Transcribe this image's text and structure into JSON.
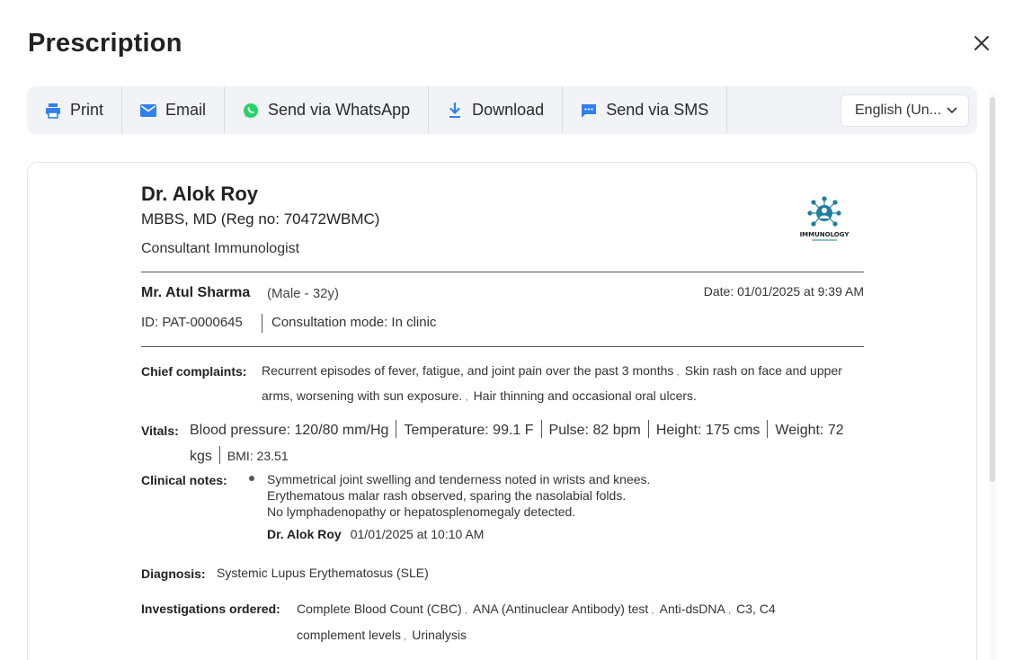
{
  "modal": {
    "title": "Prescription"
  },
  "toolbar": {
    "print": "Print",
    "email": "Email",
    "whatsapp": "Send via WhatsApp",
    "download": "Download",
    "sms": "Send via SMS",
    "language": "English (Un..."
  },
  "doctor": {
    "name": "Dr. Alok Roy",
    "qualification": "MBBS, MD (Reg no: 70472WBMC)",
    "title": "Consultant Immunologist",
    "logo_text": "IMMUNOLOGY"
  },
  "patient": {
    "name": "Mr. Atul Sharma",
    "meta": "(Male - 32y)",
    "date": "Date: 01/01/2025 at 9:39 AM",
    "id": "ID: PAT-0000645",
    "mode": "Consultation mode: In clinic"
  },
  "complaints": {
    "label": "Chief complaints:",
    "items": [
      "Recurrent episodes of fever, fatigue, and joint pain over the past 3 months",
      "Skin rash on face and upper arms, worsening with sun exposure.",
      "Hair thinning and occasional oral ulcers."
    ]
  },
  "vitals": {
    "label": "Vitals:",
    "bp": "Blood pressure: 120/80 mm/Hg",
    "temp": "Temperature: 99.1 F",
    "pulse": "Pulse: 82 bpm",
    "height": "Height: 175 cms",
    "weight": "Weight: 72 kgs",
    "bmi": "BMI: 23.51"
  },
  "clinical_notes": {
    "label": "Clinical notes:",
    "lines": [
      "Symmetrical joint swelling and tenderness noted in wrists and knees.",
      "Erythematous malar rash observed, sparing the nasolabial folds.",
      "No lymphadenopathy or hepatosplenomegaly detected."
    ],
    "author": "Dr. Alok Roy",
    "timestamp": "01/01/2025 at 10:10 AM"
  },
  "diagnosis": {
    "label": "Diagnosis:",
    "value": "Systemic Lupus Erythematosus (SLE)"
  },
  "investigations": {
    "label": "Investigations ordered:",
    "items": [
      "Complete Blood Count (CBC)",
      "ANA (Antinuclear Antibody) test",
      "Anti-dsDNA",
      "C3, C4 complement levels",
      "Urinalysis"
    ]
  },
  "colors": {
    "accent": "#2f80ed",
    "whatsapp": "#25d366",
    "logo": "#1e7fa0"
  }
}
